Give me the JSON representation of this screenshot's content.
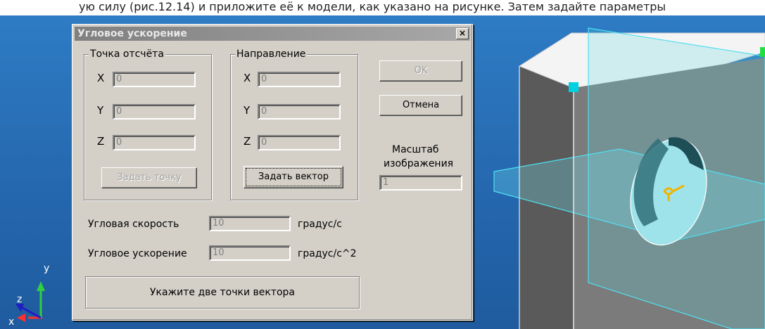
{
  "top_strip_text": "ую силу (рис.12.14) и приложите её к модели, как указано на рисунке. Затем задайте параметры",
  "dialog": {
    "title": "Угловое ускорение",
    "close_label": "×",
    "origin_group": {
      "legend": "Точка отсчёта",
      "rows": [
        {
          "axis": "X",
          "value": "0"
        },
        {
          "axis": "Y",
          "value": "0"
        },
        {
          "axis": "Z",
          "value": "0"
        }
      ],
      "button_label": "Задать точку"
    },
    "direction_group": {
      "legend": "Направление",
      "rows": [
        {
          "axis": "X",
          "value": "0"
        },
        {
          "axis": "Y",
          "value": "0"
        },
        {
          "axis": "Z",
          "value": "0"
        }
      ],
      "button_label": "Задать вектор"
    },
    "ok_label": "OK",
    "cancel_label": "Отмена",
    "scale_label_line1": "Масштаб",
    "scale_label_line2": "изображения",
    "scale_value": "1",
    "angular_velocity": {
      "label": "Угловая скорость",
      "value": "10",
      "unit": "градус/с"
    },
    "angular_acceleration": {
      "label": "Угловое ускорение",
      "value": "10",
      "unit": "градус/с^2"
    },
    "status": "Укажите две точки вектора"
  },
  "triad": {
    "y": "y",
    "z": "z",
    "x": "x"
  },
  "colors": {
    "background": "#2a6fb3",
    "plane": "#4fd2e6",
    "marker": "#00d0e0",
    "vector": "#f0b400"
  }
}
